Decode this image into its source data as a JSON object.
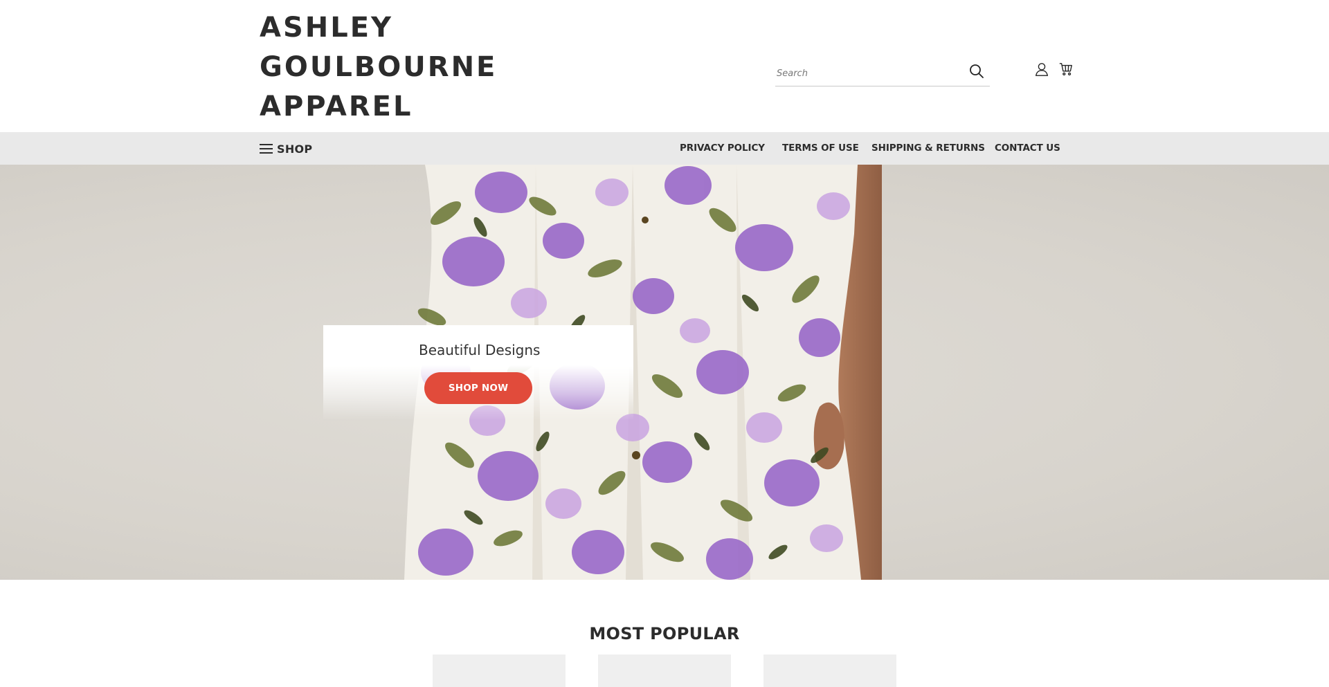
{
  "brand": {
    "line1": "ASHLEY",
    "line2": "GOULBOURNE",
    "line3": "APPAREL"
  },
  "search": {
    "placeholder": "Search",
    "icon": "search-icon"
  },
  "header_icons": {
    "account": "user-icon",
    "cart": "cart-icon"
  },
  "nav": {
    "shop_label": "SHOP",
    "shop_icon": "hamburger-icon",
    "links": [
      {
        "label": "PRIVACY POLICY"
      },
      {
        "label": "TERMS OF USE"
      },
      {
        "label": "SHIPPING & RETURNS"
      },
      {
        "label": "CONTACT US"
      }
    ]
  },
  "hero": {
    "title": "Beautiful Designs",
    "cta_label": "SHOP NOW"
  },
  "most_popular": {
    "title": "MOST POPULAR"
  },
  "colors": {
    "accent": "#e14b3b",
    "nav_bg": "#e9e9e9",
    "text_dark": "#2c2c2c",
    "hero_bg": "#d8d4cd"
  }
}
